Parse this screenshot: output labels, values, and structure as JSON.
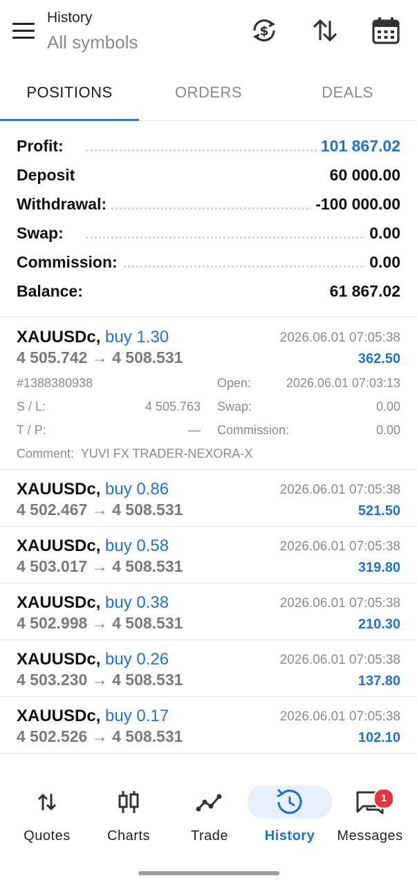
{
  "header": {
    "title": "History",
    "subtitle": "All symbols"
  },
  "tabs": [
    {
      "label": "POSITIONS",
      "active": true
    },
    {
      "label": "ORDERS",
      "active": false
    },
    {
      "label": "DEALS",
      "active": false
    }
  ],
  "summary": [
    {
      "label": "Profit:",
      "value": "101 867.02",
      "color": "#1f72d3"
    },
    {
      "label": "Deposit",
      "value": "60 000.00"
    },
    {
      "label": "Withdrawal:",
      "value": "-100 000.00"
    },
    {
      "label": "Swap:",
      "value": "0.00"
    },
    {
      "label": "Commission:",
      "value": "0.00"
    },
    {
      "label": "Balance:",
      "value": "61 867.02"
    }
  ],
  "deals": [
    {
      "symbol": "XAUUSDc,",
      "side": "buy 1.30",
      "time": "2026.06.01 07:05:38",
      "open_price": "4 505.742",
      "arrow": "→",
      "close_price": "4 508.531",
      "profit": "362.50"
    },
    {
      "symbol": "XAUUSDc,",
      "side": "buy 0.86",
      "time": "2026.06.01 07:05:38",
      "open_price": "4 502.467",
      "arrow": "→",
      "close_price": "4 508.531",
      "profit": "521.50"
    },
    {
      "symbol": "XAUUSDc,",
      "side": "buy 0.58",
      "time": "2026.06.01 07:05:38",
      "open_price": "4 503.017",
      "arrow": "→",
      "close_price": "4 508.531",
      "profit": "319.80"
    },
    {
      "symbol": "XAUUSDc,",
      "side": "buy 0.38",
      "time": "2026.06.01 07:05:38",
      "open_price": "4 502.998",
      "arrow": "→",
      "close_price": "4 508.531",
      "profit": "210.30"
    },
    {
      "symbol": "XAUUSDc,",
      "side": "buy 0.26",
      "time": "2026.06.01 07:05:38",
      "open_price": "4 503.230",
      "arrow": "→",
      "close_price": "4 508.531",
      "profit": "137.80"
    },
    {
      "symbol": "XAUUSDc,",
      "side": "buy 0.17",
      "time": "2026.06.01 07:05:38",
      "open_price": "4 502.526",
      "arrow": "→",
      "close_price": "4 508.531",
      "profit": "102.10"
    }
  ],
  "details": {
    "ticket": "#1388380938",
    "open_label": "Open:",
    "open_time": "2026.06.01 07:03:13",
    "sl_label": "S / L:",
    "sl_value": "4 505.763",
    "swap_label": "Swap:",
    "swap_value": "0.00",
    "tp_label": "T / P:",
    "tp_value": "—",
    "commission_label": "Commission:",
    "commission_value": "0.00",
    "comment_label": "Comment:",
    "comment_value": "YUVI FX TRADER-NEXORA-X"
  },
  "nav": [
    {
      "label": "Quotes",
      "icon": "quotes-arrows-icon"
    },
    {
      "label": "Charts",
      "icon": "candlestick-icon"
    },
    {
      "label": "Trade",
      "icon": "trade-line-icon"
    },
    {
      "label": "History",
      "icon": "history-clock-icon",
      "active": true
    },
    {
      "label": "Messages",
      "icon": "messages-icon",
      "badge": "1"
    }
  ],
  "colors": {
    "accent": "#1f72d3",
    "badge": "#e5343c"
  }
}
